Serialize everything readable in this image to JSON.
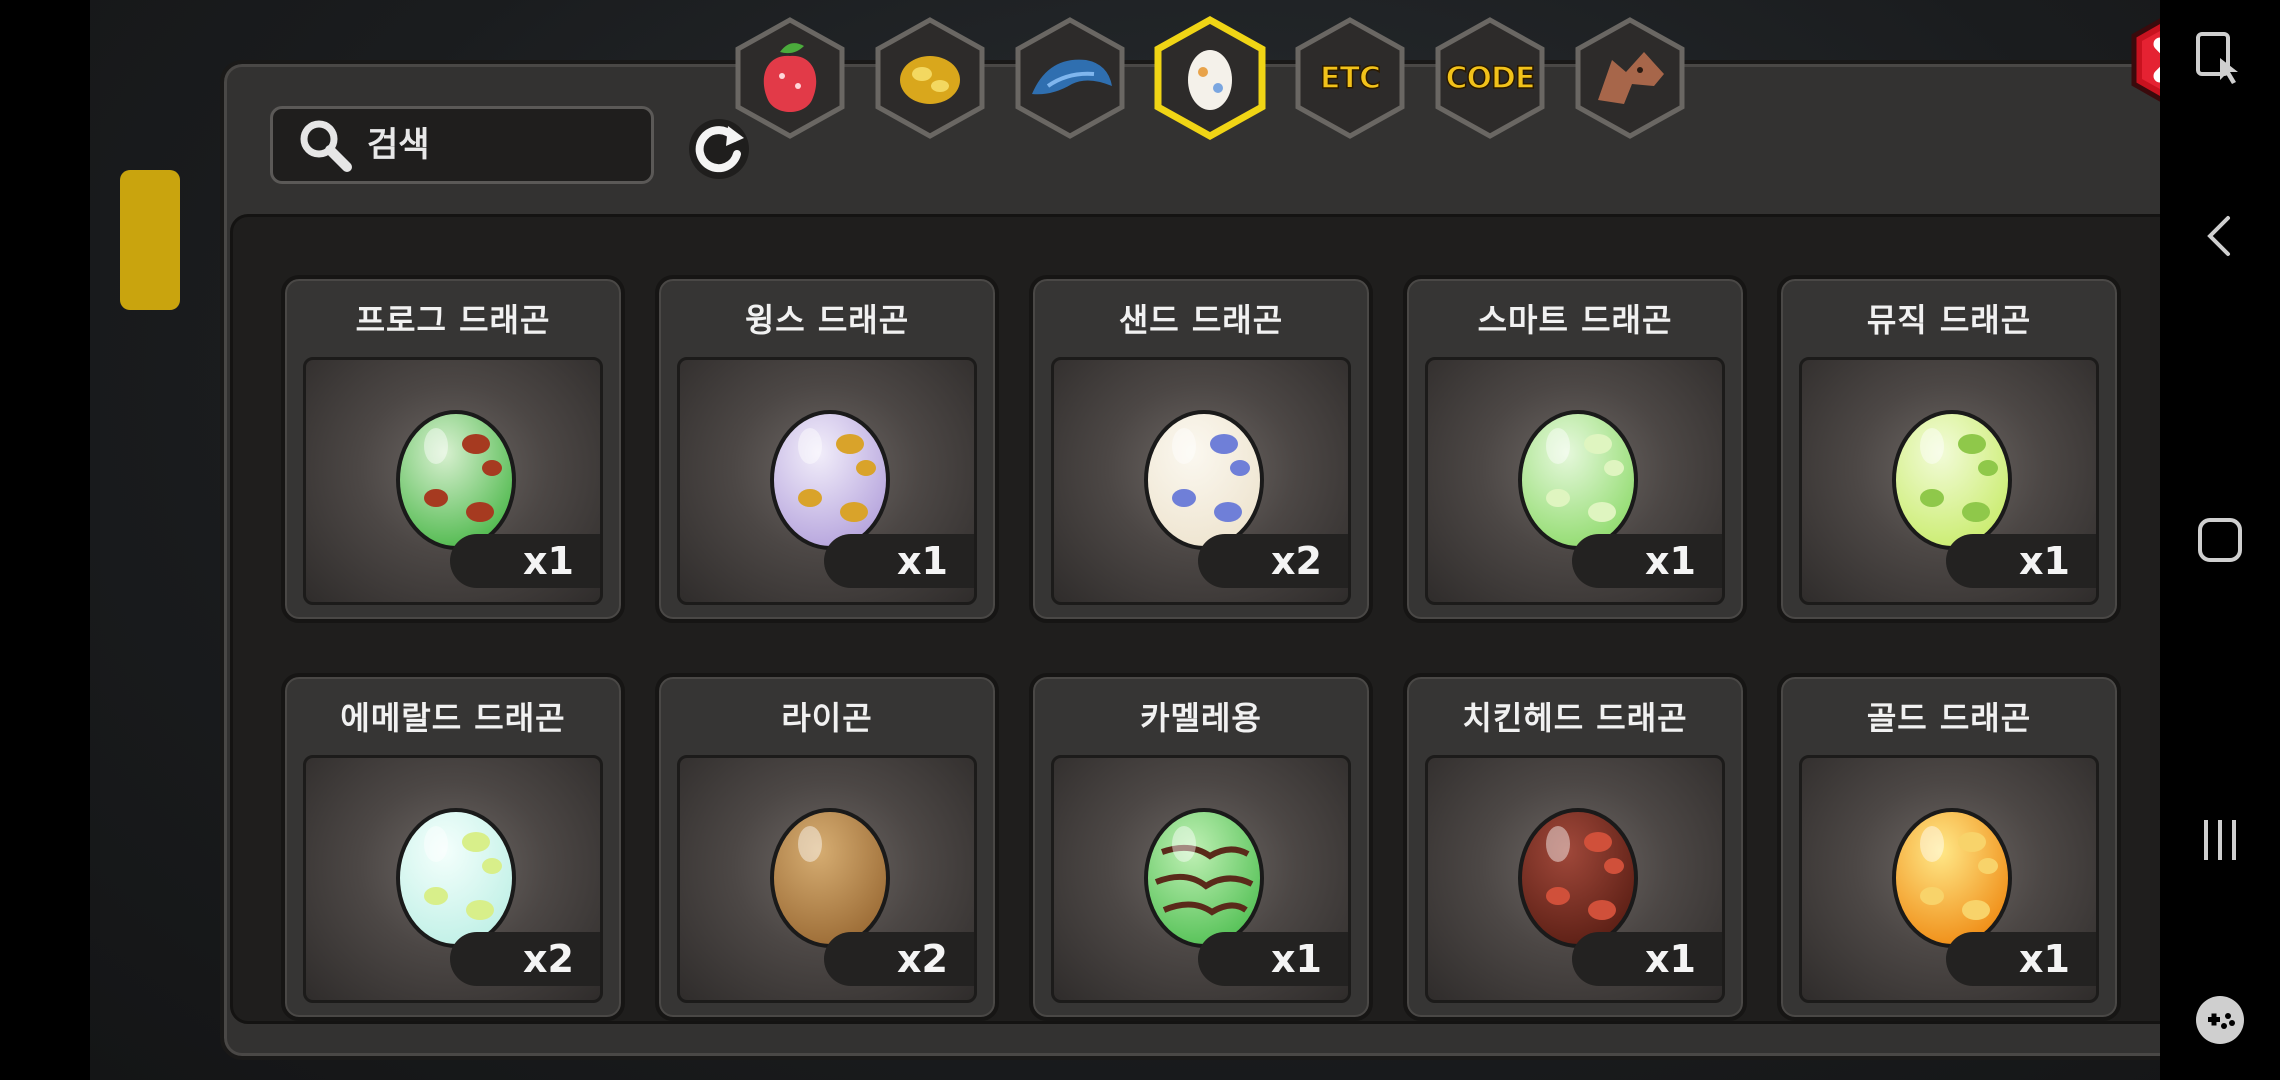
{
  "search": {
    "placeholder": "검색"
  },
  "tabs": [
    {
      "id": "fruit",
      "icon": "strawberry-icon",
      "label": ""
    },
    {
      "id": "gold",
      "icon": "gold-nugget-icon",
      "label": ""
    },
    {
      "id": "scale",
      "icon": "dragon-scale-icon",
      "label": ""
    },
    {
      "id": "egg",
      "icon": "egg-icon",
      "label": "",
      "selected": true
    },
    {
      "id": "etc",
      "icon": "",
      "label": "ETC"
    },
    {
      "id": "code",
      "icon": "",
      "label": "CODE"
    },
    {
      "id": "dragon",
      "icon": "dragon-head-icon",
      "label": ""
    }
  ],
  "colors": {
    "tab_selected_border": "#f0d515",
    "close_red": "#e0182a",
    "accent_text": "#f2c21a"
  },
  "eggs": [
    {
      "name": "프로그 드래곤",
      "count": "x1",
      "base": "#4cb84a",
      "top": "#d8f0d0",
      "spot": "#a63a20"
    },
    {
      "name": "윙스 드래곤",
      "count": "x1",
      "base": "#b4a2dc",
      "top": "#f2eefa",
      "spot": "#d9a32a"
    },
    {
      "name": "샌드 드래곤",
      "count": "x2",
      "base": "#eee4cf",
      "top": "#fbf8f0",
      "spot": "#6f7fd8"
    },
    {
      "name": "스마트 드래곤",
      "count": "x1",
      "base": "#8fdb6c",
      "top": "#e6f8dc",
      "spot": "#dff5c0"
    },
    {
      "name": "뮤직 드래곤",
      "count": "x1",
      "base": "#c9ec6c",
      "top": "#f2fbd8",
      "spot": "#8fc84a"
    },
    {
      "name": "에메랄드 드래곤",
      "count": "x2",
      "base": "#bff0e6",
      "top": "#f4fffc",
      "spot": "#d8ef8a"
    },
    {
      "name": "라이곤",
      "count": "x2",
      "base": "#9a6a34",
      "top": "#d6ad72",
      "spot": "#9a6a34"
    },
    {
      "name": "카멜레용",
      "count": "x1",
      "base": "#52c054",
      "top": "#bff0b4",
      "spot": "#5a2a1a"
    },
    {
      "name": "치킨헤드 드래곤",
      "count": "x1",
      "base": "#5a1e14",
      "top": "#a0483a",
      "spot": "#d0503a"
    },
    {
      "name": "골드 드래곤",
      "count": "x1",
      "base": "#ef8a12",
      "top": "#ffe888",
      "spot": "#f8d36a"
    }
  ],
  "system_nav": {
    "icons": [
      "screen-touch-icon",
      "back-icon",
      "home-icon",
      "recents-icon",
      "game-tools-icon"
    ]
  }
}
